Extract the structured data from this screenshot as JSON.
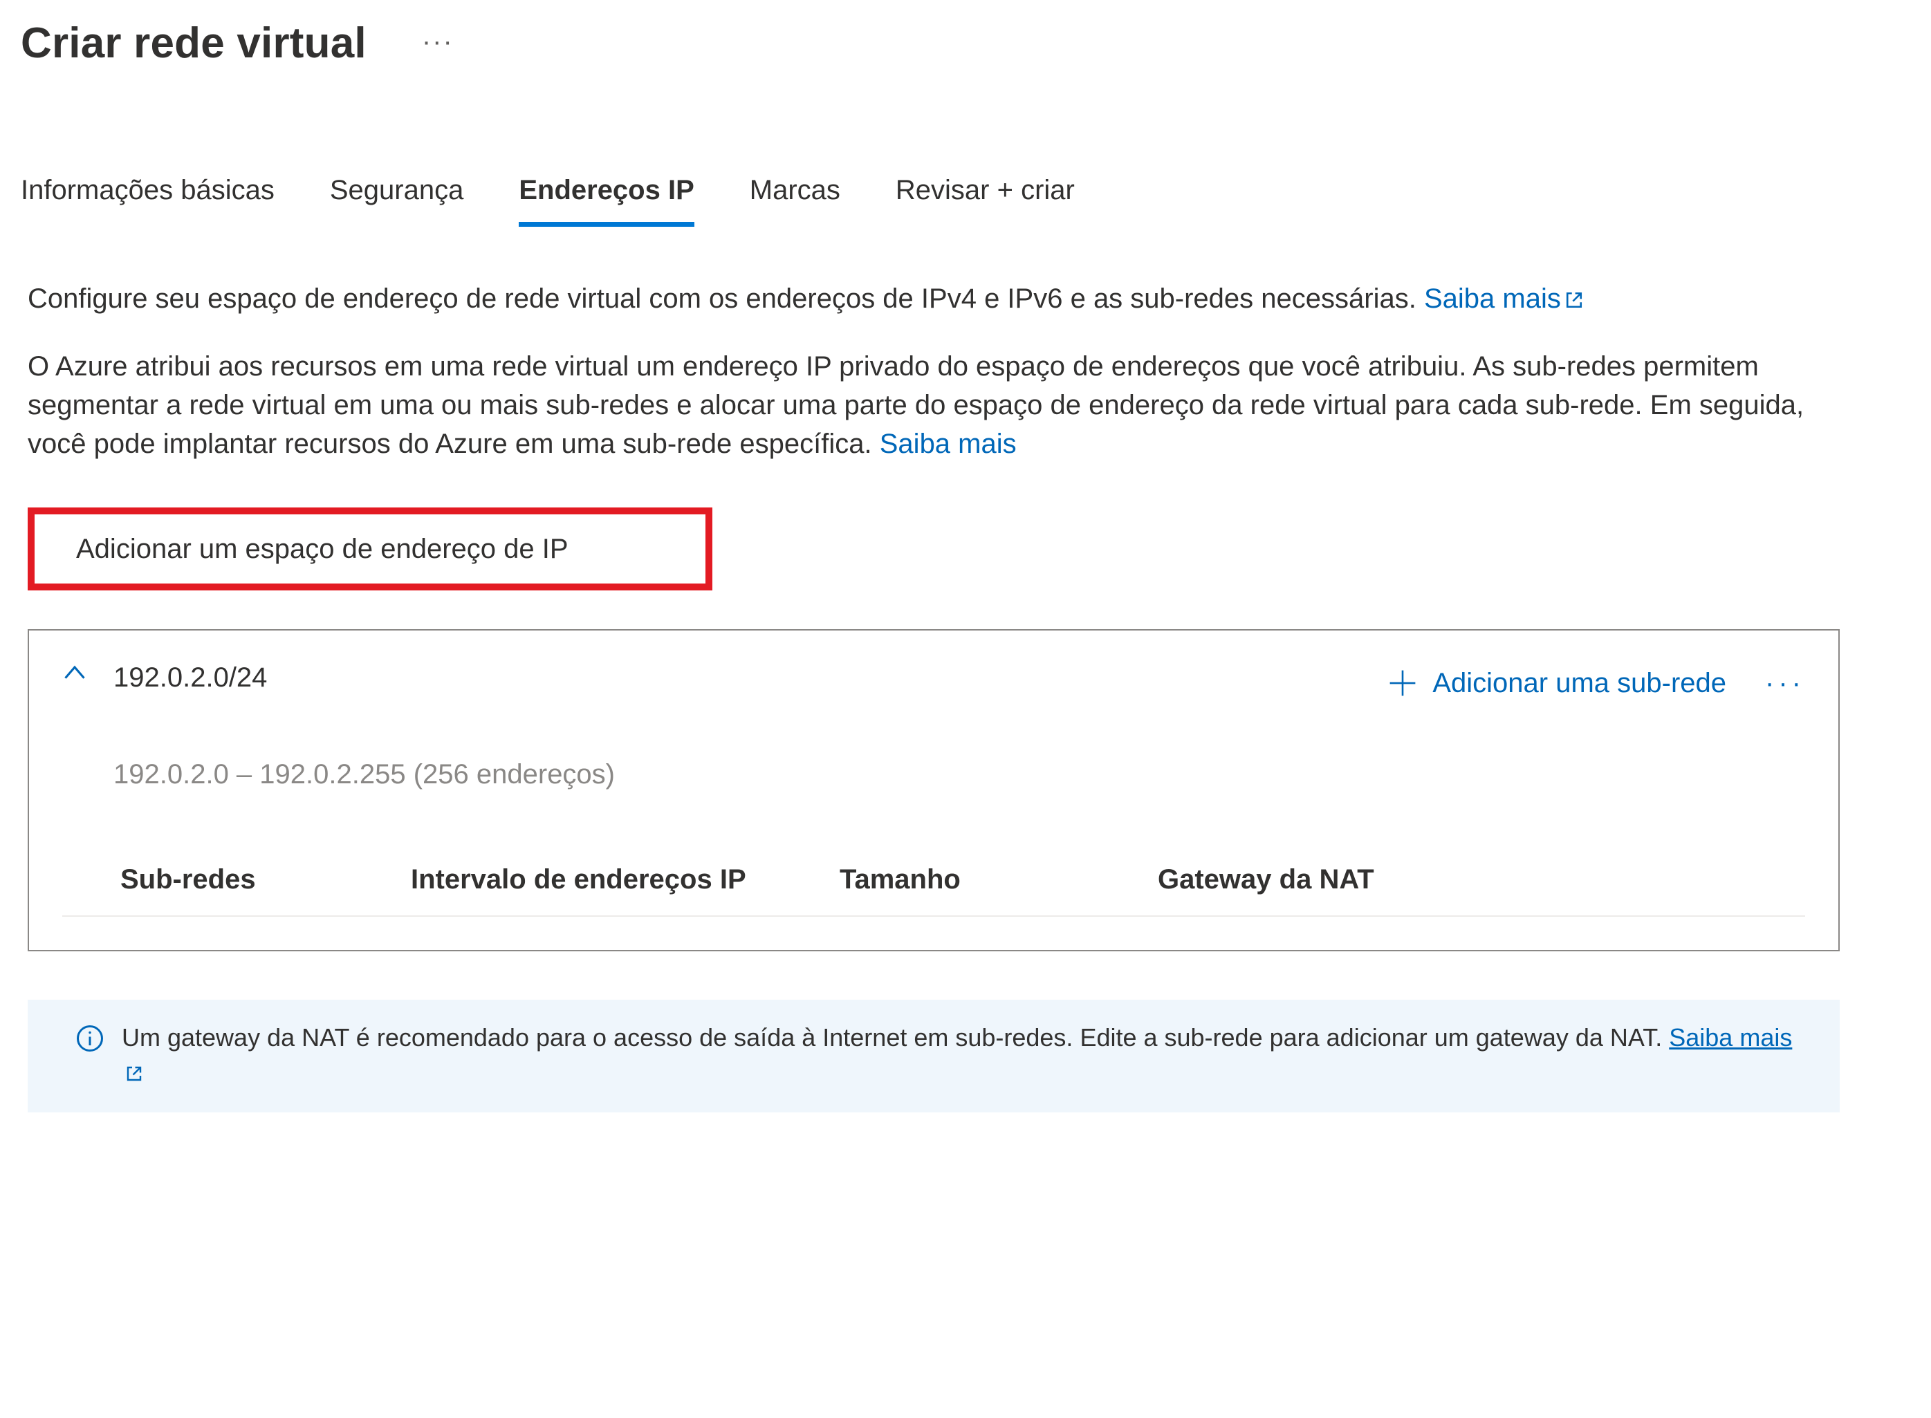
{
  "header": {
    "title": "Criar rede virtual"
  },
  "tabs": [
    {
      "id": "basics",
      "label": "Informações básicas",
      "active": false
    },
    {
      "id": "security",
      "label": "Segurança",
      "active": false
    },
    {
      "id": "ip",
      "label": "Endereços IP",
      "active": true
    },
    {
      "id": "tags",
      "label": "Marcas",
      "active": false
    },
    {
      "id": "review",
      "label": "Revisar + criar",
      "active": false
    }
  ],
  "intro": {
    "line1_prefix": "Configure seu espaço de endereço de rede virtual com os endereços de IPv4 e IPv6 e as sub-redes necessárias. ",
    "line1_link": "Saiba mais",
    "line2_prefix": "O Azure atribui aos recursos em uma rede virtual um endereço IP privado do espaço de endereços que você atribuiu. As sub-redes permitem segmentar a rede virtual em uma ou mais sub-redes e alocar uma parte do espaço de endereço da rede virtual para cada sub-rede. Em seguida, você pode implantar recursos do Azure em uma sub-rede específica. ",
    "line2_link": "Saiba mais"
  },
  "buttons": {
    "add_address_space": "Adicionar um espaço de endereço de IP",
    "add_subnet": "Adicionar uma sub-rede"
  },
  "address_space": {
    "cidr": "192.0.2.0/24",
    "range": "192.0.2.0 – 192.0.2.255 (256 endereços)"
  },
  "table": {
    "cols": {
      "subnets": "Sub-redes",
      "ip_range": "Intervalo de endereços IP",
      "size": "Tamanho",
      "nat_gateway": "Gateway da NAT"
    }
  },
  "info": {
    "text_prefix": "Um gateway da NAT é recomendado para o acesso de saída à Internet em sub-redes. Edite a sub-rede para adicionar um gateway da NAT. ",
    "link": "Saiba mais"
  }
}
